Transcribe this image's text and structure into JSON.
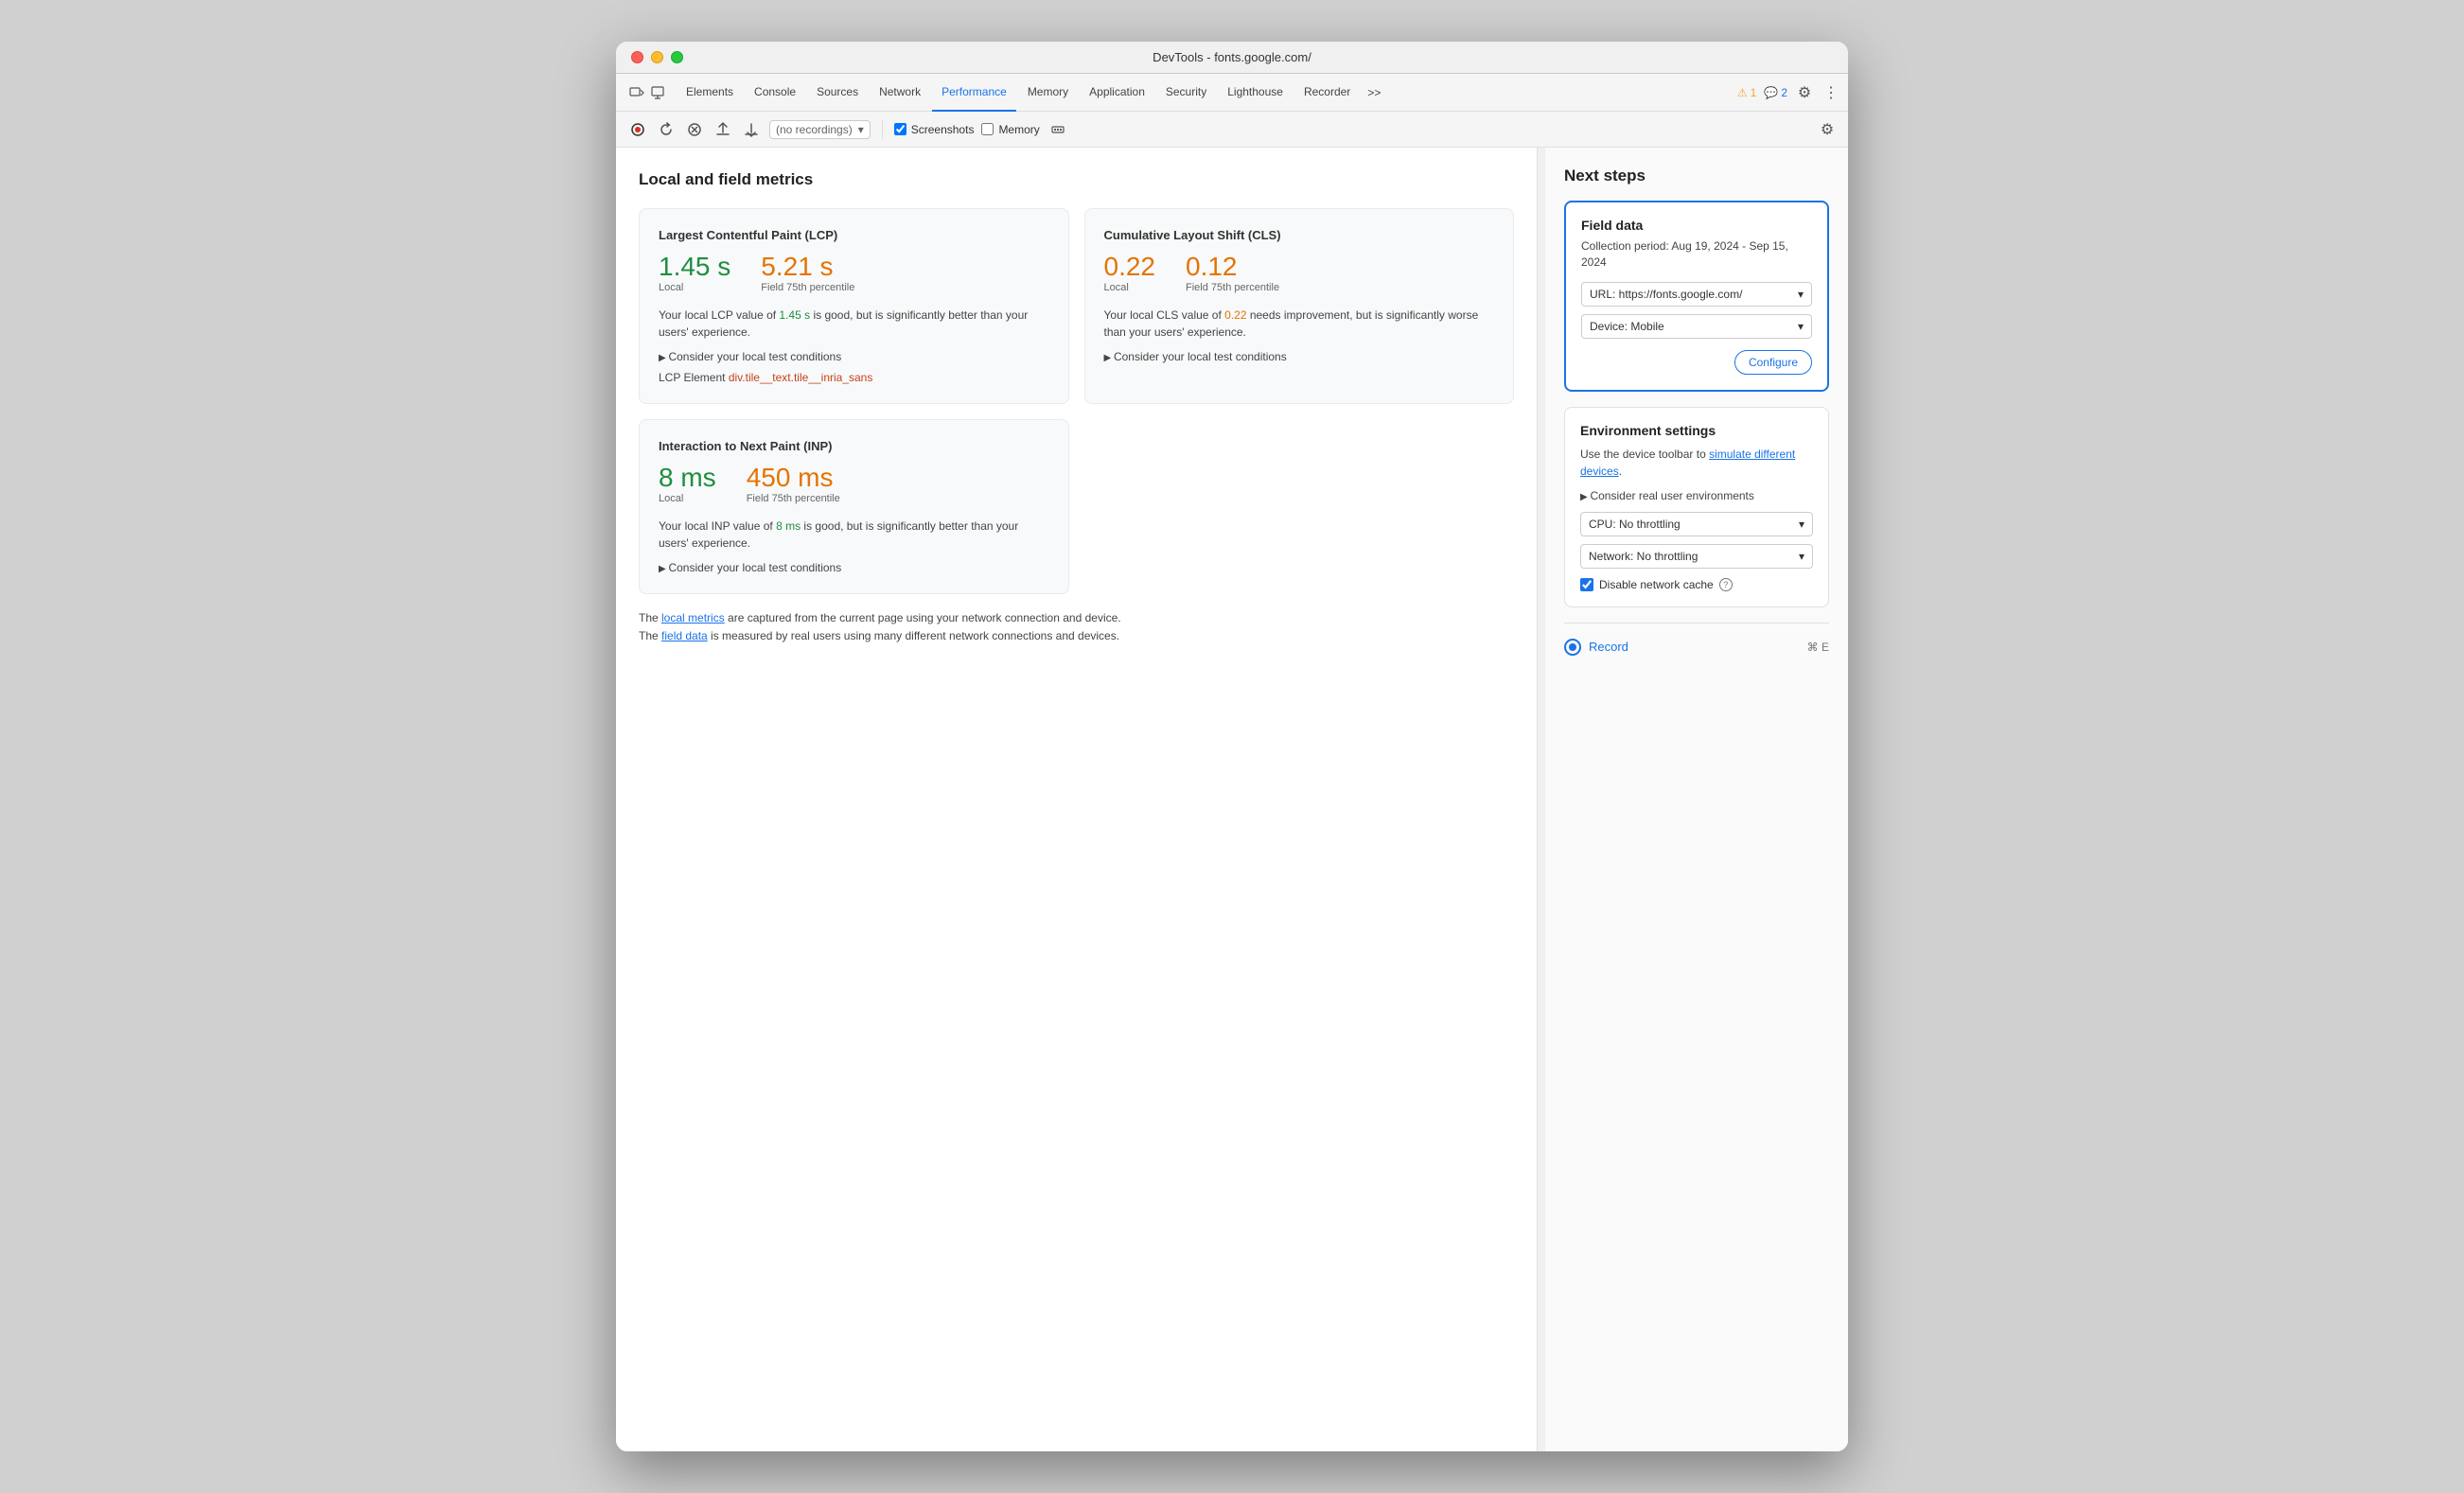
{
  "window": {
    "title": "DevTools - fonts.google.com/"
  },
  "tabs": {
    "items": [
      {
        "id": "elements",
        "label": "Elements"
      },
      {
        "id": "console",
        "label": "Console"
      },
      {
        "id": "sources",
        "label": "Sources"
      },
      {
        "id": "network",
        "label": "Network"
      },
      {
        "id": "performance",
        "label": "Performance",
        "active": true
      },
      {
        "id": "memory",
        "label": "Memory"
      },
      {
        "id": "application",
        "label": "Application"
      },
      {
        "id": "security",
        "label": "Security"
      },
      {
        "id": "lighthouse",
        "label": "Lighthouse"
      },
      {
        "id": "recorder",
        "label": "Recorder"
      }
    ],
    "overflow_label": ">>",
    "warnings": "1",
    "messages": "2"
  },
  "toolbar": {
    "recordings_placeholder": "(no recordings)",
    "screenshots_label": "Screenshots",
    "memory_label": "Memory",
    "screenshots_checked": true,
    "memory_checked": false
  },
  "main": {
    "section_title": "Local and field metrics",
    "lcp_card": {
      "title": "Largest Contentful Paint (LCP)",
      "local_value": "1.45 s",
      "field_value": "5.21 s",
      "local_label": "Local",
      "field_label": "Field 75th percentile",
      "description_prefix": "Your local LCP value of ",
      "description_local_val": "1.45 s",
      "description_middle": " is good, but is significantly better than your users' experience.",
      "consider_link": "Consider your local test conditions",
      "lcp_element_label": "LCP Element",
      "lcp_element_value": "div.tile__text.tile__inria_sans"
    },
    "cls_card": {
      "title": "Cumulative Layout Shift (CLS)",
      "local_value": "0.22",
      "field_value": "0.12",
      "local_label": "Local",
      "field_label": "Field 75th percentile",
      "description_prefix": "Your local CLS value of ",
      "description_local_val": "0.22",
      "description_middle": " needs improvement, but is significantly worse than your users' experience.",
      "consider_link": "Consider your local test conditions"
    },
    "inp_card": {
      "title": "Interaction to Next Paint (INP)",
      "local_value": "8 ms",
      "field_value": "450 ms",
      "local_label": "Local",
      "field_label": "Field 75th percentile",
      "description_prefix": "Your local INP value of ",
      "description_local_val": "8 ms",
      "description_middle": " is good, but is significantly better than your users' experience.",
      "consider_link": "Consider your local test conditions"
    },
    "footer": {
      "line1_prefix": "The ",
      "line1_link": "local metrics",
      "line1_suffix": " are captured from the current page using your network connection and device.",
      "line2_prefix": "The ",
      "line2_link": "field data",
      "line2_suffix": " is measured by real users using many different network connections and devices."
    }
  },
  "sidebar": {
    "title": "Next steps",
    "field_data": {
      "title": "Field data",
      "period": "Collection period: Aug 19, 2024 - Sep 15, 2024",
      "url_label": "URL: https://fonts.google.com/",
      "device_label": "Device: Mobile",
      "configure_label": "Configure"
    },
    "env_settings": {
      "title": "Environment settings",
      "desc_prefix": "Use the device toolbar to ",
      "desc_link": "simulate different devices",
      "desc_suffix": ".",
      "consider_link": "Consider real user environments",
      "cpu_label": "CPU: No throttling",
      "network_label": "Network: No throttling",
      "disable_cache_label": "Disable network cache",
      "cache_checked": true
    },
    "record": {
      "label": "Record",
      "shortcut": "⌘ E"
    }
  },
  "colors": {
    "good": "#1e8e3e",
    "needs_improvement": "#e37400",
    "poor": "#d93025",
    "blue": "#1a73e8",
    "orange_link": "#c5441c"
  }
}
